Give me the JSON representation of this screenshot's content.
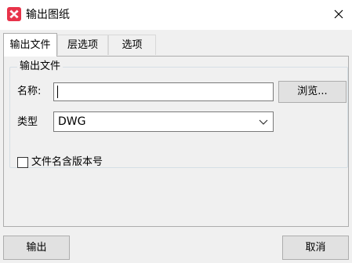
{
  "window": {
    "title": "输出图纸",
    "icon": "app-logo-icon",
    "close_icon": "close-icon"
  },
  "tabs": [
    {
      "label": "输出文件",
      "active": true
    },
    {
      "label": "层选项",
      "active": false
    },
    {
      "label": "选项",
      "active": false
    }
  ],
  "output_group": {
    "legend": "输出文件",
    "name_label": "名称:",
    "name_value": "",
    "browse_label": "浏览...",
    "type_label": "类型",
    "type_value": "DWG",
    "include_version_label": "文件名含版本号",
    "include_version_checked": false
  },
  "footer": {
    "output_label": "输出",
    "cancel_label": "取消"
  },
  "colors": {
    "dialog_bg": "#f0f0f0",
    "logo_red": "#e8334a"
  }
}
